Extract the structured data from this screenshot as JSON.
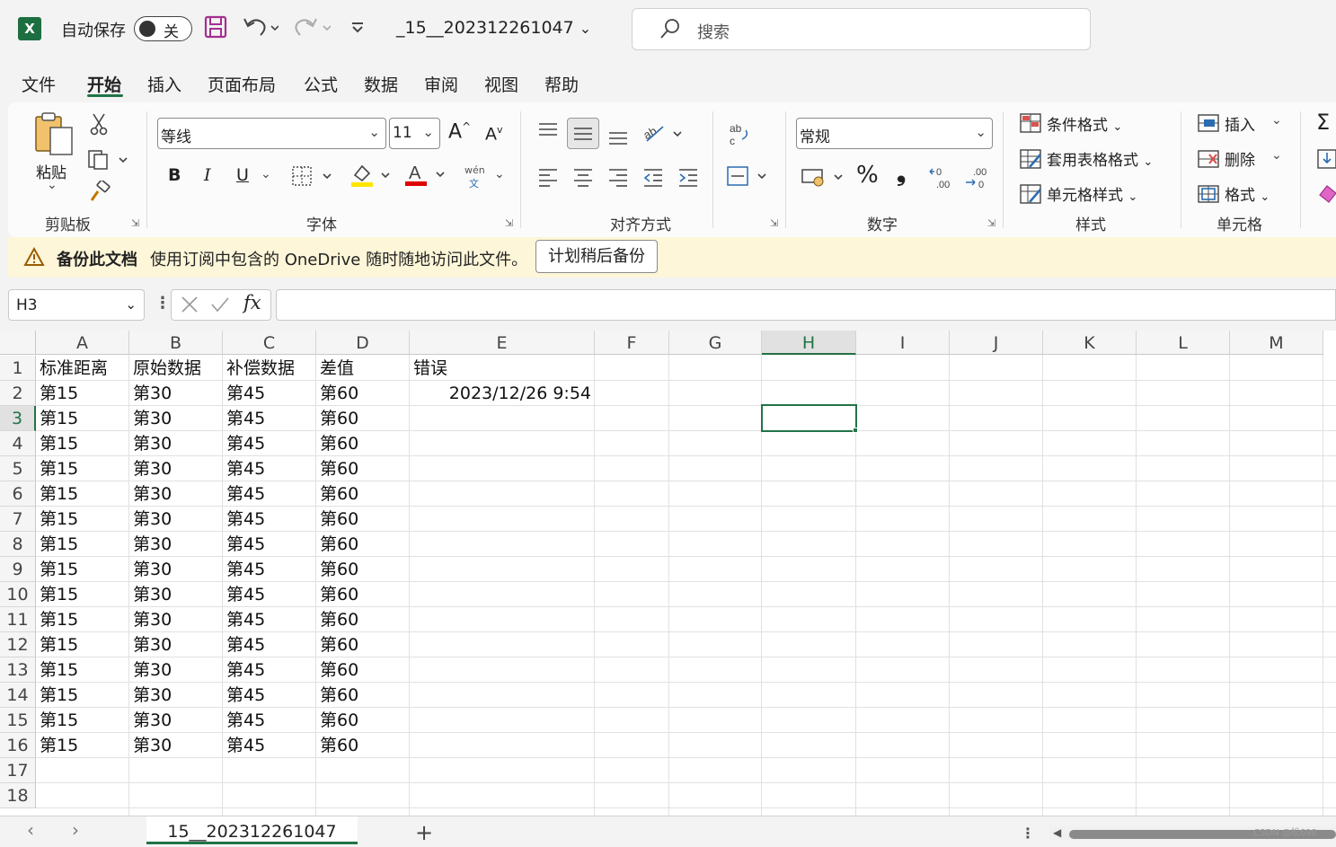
{
  "titlebar": {
    "app_icon": "X",
    "autosave_label": "自动保存",
    "autosave_state": "关",
    "doc_title": "_15__202312261047",
    "search_placeholder": "搜索",
    "icons": [
      "save-icon",
      "undo-icon",
      "redo-icon",
      "customize-qat-icon"
    ]
  },
  "menu": {
    "tabs": [
      "文件",
      "开始",
      "插入",
      "页面布局",
      "公式",
      "数据",
      "审阅",
      "视图",
      "帮助"
    ],
    "active": "开始"
  },
  "ribbon": {
    "clipboard": {
      "paste_label": "粘贴",
      "group_label": "剪贴板"
    },
    "font": {
      "font_name": "等线",
      "font_size": "11",
      "group_label": "字体",
      "bold": "B",
      "italic": "I",
      "underline": "U",
      "phonetic_top": "wén",
      "phonetic_bottom": "文"
    },
    "alignment": {
      "group_label": "对齐方式"
    },
    "number": {
      "format": "常规",
      "percent": "%",
      "comma": "❟",
      "group_label": "数字"
    },
    "styles": {
      "conditional": "条件格式",
      "table": "套用表格格式",
      "cell_styles": "单元格样式",
      "group_label": "样式"
    },
    "cells": {
      "insert": "插入",
      "delete": "删除",
      "format": "格式",
      "group_label": "单元格"
    }
  },
  "infobar": {
    "title": "备份此文档",
    "message": "使用订阅中包含的 OneDrive 随时随地访问此文件。",
    "button": "计划稍后备份"
  },
  "formula_bar": {
    "name_box": "H3",
    "fx": "fx",
    "value": ""
  },
  "grid": {
    "columns": [
      "A",
      "B",
      "C",
      "D",
      "E",
      "F",
      "G",
      "H",
      "I",
      "J",
      "K",
      "L",
      "M"
    ],
    "selected_column": "H",
    "rows": [
      "1",
      "2",
      "3",
      "4",
      "5",
      "6",
      "7",
      "8",
      "9",
      "10",
      "11",
      "12",
      "13",
      "14",
      "15",
      "16",
      "17",
      "18"
    ],
    "selected_row": "3",
    "header": [
      "标准距离",
      "原始数据",
      "补偿数据",
      "差值",
      "错误"
    ],
    "data_row": [
      "第15",
      "第30",
      "第45",
      "第60"
    ],
    "data_row_count": 15,
    "e2_value": "2023/12/26 9:54",
    "active_cell": "H3"
  },
  "sheetbar": {
    "sheet_name": "15__202312261047",
    "add_label": "+",
    "watermark": "CSDN @松698"
  },
  "colors": {
    "accent": "#217346",
    "info_bg": "#fdf6d8"
  }
}
